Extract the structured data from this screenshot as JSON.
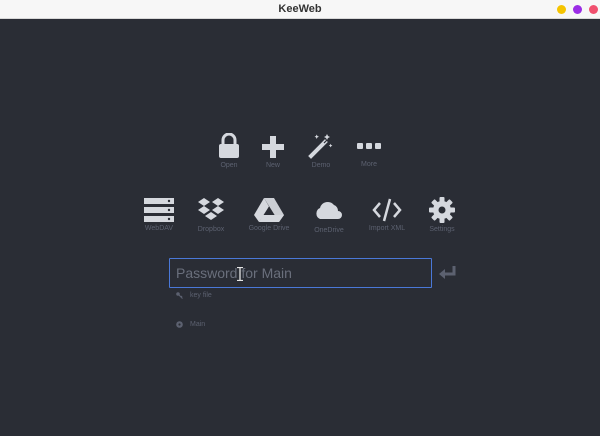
{
  "window": {
    "title": "KeeWeb"
  },
  "colors": {
    "accent": "#4a78d8",
    "background": "#2a2d35",
    "icon": "#d5d8de",
    "label": "#5c6170"
  },
  "actions_top": [
    {
      "icon": "lock-icon",
      "label": "Open"
    },
    {
      "icon": "plus-icon",
      "label": "New"
    },
    {
      "icon": "magic-wand-icon",
      "label": "Demo"
    },
    {
      "icon": "ellipsis-icon",
      "label": "More"
    }
  ],
  "actions_storage": [
    {
      "icon": "server-icon",
      "label": "WebDAV"
    },
    {
      "icon": "dropbox-icon",
      "label": "Dropbox"
    },
    {
      "icon": "google-drive-icon",
      "label": "Google Drive"
    },
    {
      "icon": "onedrive-icon",
      "label": "OneDrive"
    },
    {
      "icon": "code-icon",
      "label": "Import XML"
    },
    {
      "icon": "gear-icon",
      "label": "Settings"
    }
  ],
  "password": {
    "placeholder": "Password for Main",
    "value": ""
  },
  "keyfile": {
    "label": "key file",
    "icon": "key-icon"
  },
  "file": {
    "label": "Main",
    "icon": "gear-icon"
  }
}
